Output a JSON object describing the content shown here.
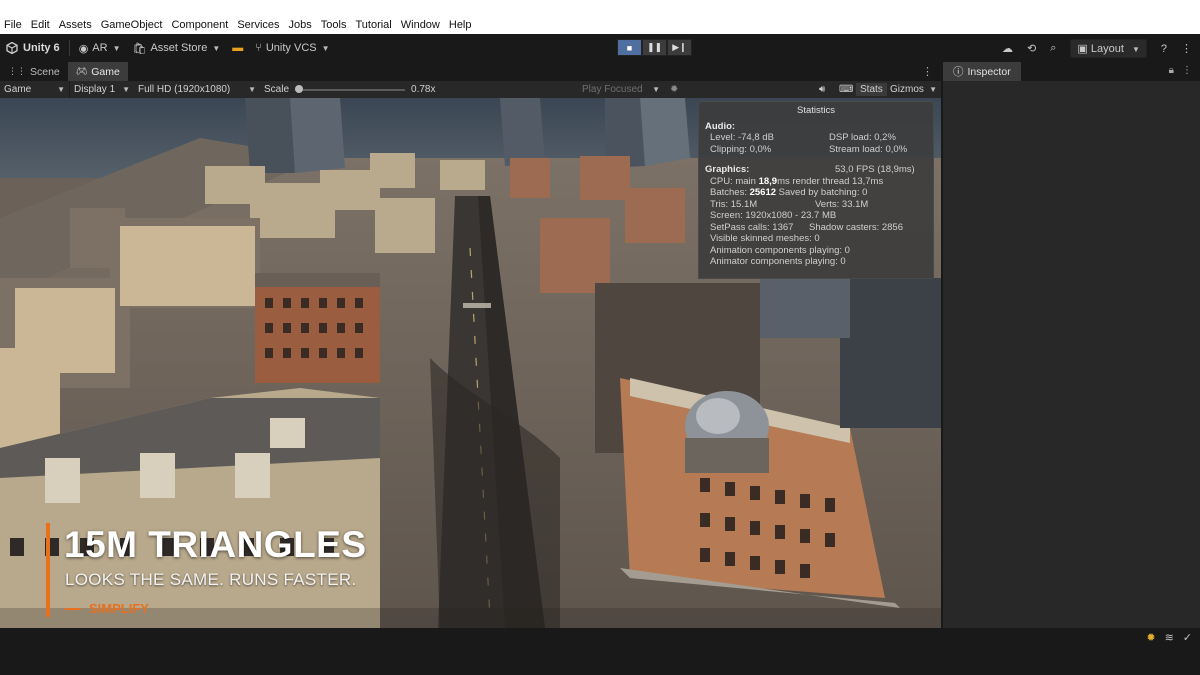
{
  "menubar": [
    "File",
    "Edit",
    "Assets",
    "GameObject",
    "Component",
    "Services",
    "Jobs",
    "Tools",
    "Tutorial",
    "Window",
    "Help"
  ],
  "toolbar": {
    "app": "Unity 6",
    "account": "AR",
    "asset_store": "Asset Store",
    "vcs": "Unity VCS",
    "layout": "Layout"
  },
  "tabs": {
    "scene": "Scene",
    "game": "Game",
    "inspector": "Inspector"
  },
  "game_toolbar": {
    "mode": "Game",
    "display": "Display 1",
    "resolution": "Full HD (1920x1080)",
    "scale_label": "Scale",
    "scale_value": "0.78x",
    "play_mode": "Play Focused",
    "stats": "Stats",
    "gizmos": "Gizmos"
  },
  "stats": {
    "title": "Statistics",
    "audio_header": "Audio:",
    "level": "Level: -74,8 dB",
    "dsp": "DSP load: 0,2%",
    "clipping": "Clipping: 0,0%",
    "stream": "Stream load: 0,0%",
    "graphics_header": "Graphics:",
    "fps": "53,0 FPS (18,9ms)",
    "cpu_prefix": "CPU: main ",
    "cpu_main": "18,9",
    "cpu_suffix": "ms  render thread 13,7ms",
    "batches_prefix": "Batches: ",
    "batches": "25612",
    "batches_suffix": "  Saved by batching: 0",
    "tris": "Tris: 15.1M",
    "verts": "Verts: 33.1M",
    "screen": "Screen: 1920x1080 - 23.7 MB",
    "setpass": "SetPass calls: 1367",
    "shadow": "Shadow casters: 2856",
    "skinned": "Visible skinned meshes: 0",
    "animation": "Animation components playing: 0",
    "animator": "Animator components playing: 0"
  },
  "promo": {
    "title": "15M TRIANGLES",
    "subtitle": "LOOKS THE SAME. RUNS FASTER.",
    "tag": "SIMPLIFY"
  },
  "colors": {
    "accent_orange": "#e8701f",
    "play_active": "#4f6fa1"
  }
}
